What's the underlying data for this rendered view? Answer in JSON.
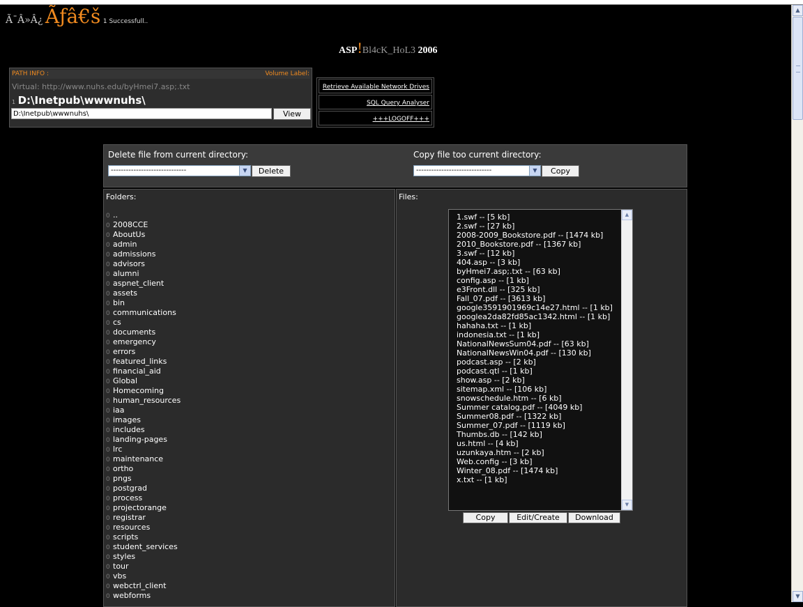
{
  "header": {
    "garble_small": "Ã¯Â»Â¿",
    "garble_big": "Ãƒâ€š",
    "status": "1 Successfull.."
  },
  "title": {
    "prefix": "ASP",
    "bang": "!",
    "name": "Bl4cK_HoL3",
    "year": "2006"
  },
  "pathinfo": {
    "label": "PATH INFO :",
    "volume_label": "Volume Label:",
    "virtual": "Virtual: http://www.nuhs.edu/byHmei7.asp;.txt",
    "drive_icon": "1",
    "current_path": "D:\\Inetpub\\wwwnuhs\\",
    "path_input": "D:\\Inetpub\\wwwnuhs\\",
    "view_button": "View"
  },
  "links": {
    "network_drives": "Retrieve Available Network Drives",
    "sql": "SQL Query Analyser",
    "logoff": "+++LOGOFF+++"
  },
  "ops": {
    "delete_label": "Delete file from current directory:",
    "delete_select": "------------------------------",
    "delete_button": "Delete",
    "copy_label": "Copy file too current directory:",
    "copy_select": "------------------------------",
    "copy_button": "Copy"
  },
  "folders": {
    "label": "Folders:",
    "icon": "0",
    "items": [
      "..",
      "2008CCE",
      "AboutUs",
      "admin",
      "admissions",
      "advisors",
      "alumni",
      "aspnet_client",
      "assets",
      "bin",
      "communications",
      "cs",
      "documents",
      "emergency",
      "errors",
      "featured_links",
      "financial_aid",
      "Global",
      "Homecoming",
      "human_resources",
      "iaa",
      "images",
      "includes",
      "landing-pages",
      "lrc",
      "maintenance",
      "ortho",
      "pngs",
      "postgrad",
      "process",
      "projectorange",
      "registrar",
      "resources",
      "scripts",
      "student_services",
      "styles",
      "tour",
      "vbs",
      "webctrl_client",
      "webforms"
    ]
  },
  "files": {
    "label": "Files:",
    "items": [
      "1.swf -- [5 kb]",
      "2.swf -- [27 kb]",
      "2008-2009_Bookstore.pdf -- [1474 kb]",
      "2010_Bookstore.pdf -- [1367 kb]",
      "3.swf -- [12 kb]",
      "404.asp -- [3 kb]",
      "byHmei7.asp;.txt -- [63 kb]",
      "config.asp -- [1 kb]",
      "e3Front.dll -- [325 kb]",
      "Fall_07.pdf -- [3613 kb]",
      "google3591901969c14e27.html -- [1 kb]",
      "googlea2da82fd85ac1342.html -- [1 kb]",
      "hahaha.txt -- [1 kb]",
      "indonesia.txt -- [1 kb]",
      "NationalNewsSum04.pdf -- [63 kb]",
      "NationalNewsWin04.pdf -- [130 kb]",
      "podcast.asp -- [2 kb]",
      "podcast.qtl -- [1 kb]",
      "show.asp -- [2 kb]",
      "sitemap.xml -- [106 kb]",
      "snowschedule.htm -- [6 kb]",
      "Summer catalog.pdf -- [4049 kb]",
      "Summer08.pdf -- [1322 kb]",
      "Summer_07.pdf -- [1119 kb]",
      "Thumbs.db -- [142 kb]",
      "us.html -- [4 kb]",
      "uzunkaya.htm -- [2 kb]",
      "Web.config -- [3 kb]",
      "Winter_08.pdf -- [1474 kb]",
      "x.txt -- [1 kb]"
    ],
    "copy_button": "Copy",
    "edit_button": "Edit/Create",
    "download_button": "Download"
  },
  "icons": {
    "scroll_up": "scroll-up-arrow-icon",
    "scroll_down": "scroll-down-arrow-icon",
    "dropdown": "chevron-down-icon"
  },
  "colors": {
    "accent": "#f08a1f",
    "background": "#000000",
    "panel": "#2b2b2b"
  }
}
